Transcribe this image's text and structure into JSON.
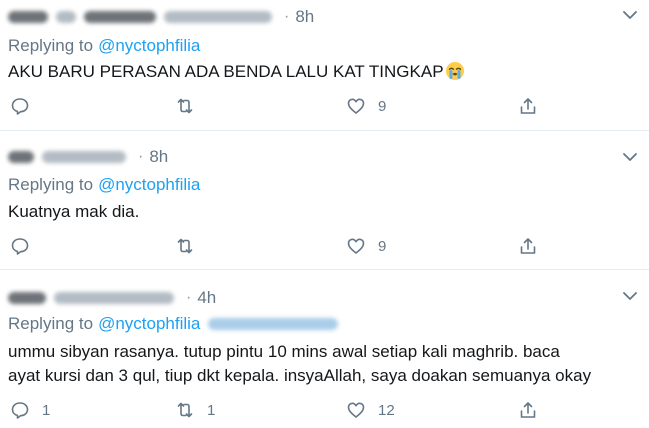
{
  "tweets": [
    {
      "time": "8h",
      "reply_prefix": "Replying to",
      "reply_handle": "@nyctophfilia",
      "lines": [
        "AKU BARU PERASAN ADA BENDA LALU KAT TINGKAP"
      ],
      "emoji": "loudly-crying-face",
      "counts": {
        "reply": "",
        "retweet": "",
        "like": "9"
      }
    },
    {
      "time": "8h",
      "reply_prefix": "Replying to",
      "reply_handle": "@nyctophfilia",
      "lines": [
        "Kuatnya mak dia."
      ],
      "counts": {
        "reply": "",
        "retweet": "",
        "like": "9"
      }
    },
    {
      "time": "4h",
      "reply_prefix": "Replying to",
      "reply_handle": "@nyctophfilia",
      "lines": [
        "ummu sibyan rasanya. tutup pintu 10 mins awal setiap kali maghrib. baca",
        "ayat kursi dan 3 qul, tiup dkt kepala. insyaAllah, saya doakan semuanya okay"
      ],
      "counts": {
        "reply": "1",
        "retweet": "1",
        "like": "12"
      }
    }
  ],
  "colors": {
    "accent": "#1da1f2",
    "muted": "#657786",
    "text": "#14171a",
    "divider": "#e6ecf0"
  },
  "icons": [
    "reply-icon",
    "retweet-icon",
    "like-icon",
    "share-icon",
    "chevron-down-icon"
  ]
}
